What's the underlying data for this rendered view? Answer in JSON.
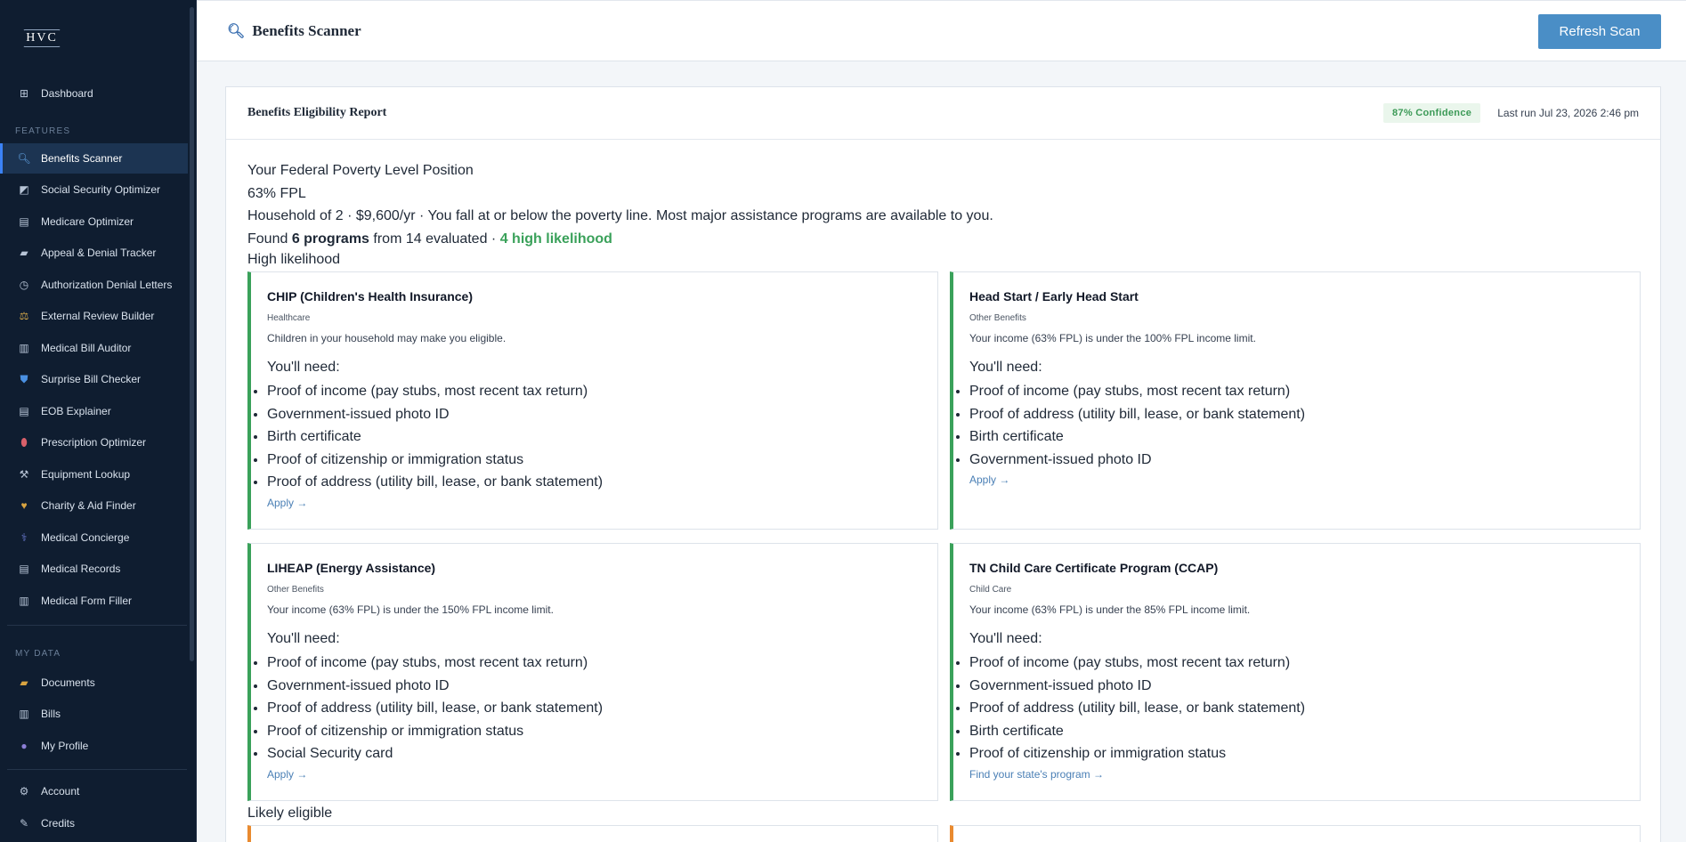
{
  "sidebar": {
    "logo": "HVC",
    "dashboard": "Dashboard",
    "features_label": "FEATURES",
    "features": [
      {
        "label": "Benefits Scanner",
        "icon": "magnifier-icon",
        "active": true
      },
      {
        "label": "Social Security Optimizer",
        "icon": "chart-icon"
      },
      {
        "label": "Medicare Optimizer",
        "icon": "document-icon"
      },
      {
        "label": "Appeal & Denial Tracker",
        "icon": "folder-icon"
      },
      {
        "label": "Authorization Denial Letters",
        "icon": "timer-icon"
      },
      {
        "label": "External Review Builder",
        "icon": "scales-icon"
      },
      {
        "label": "Medical Bill Auditor",
        "icon": "clipboard-icon"
      },
      {
        "label": "Surprise Bill Checker",
        "icon": "shield-icon"
      },
      {
        "label": "EOB Explainer",
        "icon": "document-icon"
      },
      {
        "label": "Prescription Optimizer",
        "icon": "pill-icon"
      },
      {
        "label": "Equipment Lookup",
        "icon": "tools-icon"
      },
      {
        "label": "Charity & Aid Finder",
        "icon": "heart-icon"
      },
      {
        "label": "Medical Concierge",
        "icon": "stethoscope-icon"
      },
      {
        "label": "Medical Records",
        "icon": "records-icon"
      },
      {
        "label": "Medical Form Filler",
        "icon": "form-icon"
      }
    ],
    "my_data_label": "MY DATA",
    "my_data": [
      {
        "label": "Documents",
        "icon": "folder-icon"
      },
      {
        "label": "Bills",
        "icon": "bill-icon"
      },
      {
        "label": "My Profile",
        "icon": "user-icon"
      }
    ],
    "account": [
      {
        "label": "Account",
        "icon": "gear-icon"
      },
      {
        "label": "Credits",
        "icon": "credits-icon"
      }
    ]
  },
  "header": {
    "title": "Benefits Scanner",
    "refresh_label": "Refresh Scan"
  },
  "report": {
    "title": "Benefits Eligibility Report",
    "confidence": "87% Confidence",
    "last_run": "Last run Jul 23, 2026 2:46 pm",
    "fpl_heading": "Your Federal Poverty Level Position",
    "fpl_value": "63% FPL",
    "household_line": "Household of 2 · $9,600/yr · You fall at or below the poverty line. Most major assistance programs are available to you.",
    "found_prefix": "Found ",
    "found_count": "6 programs",
    "found_middle": " from 14 evaluated · ",
    "found_high": "4 high likelihood",
    "group_high": "High likelihood",
    "group_likely": "Likely eligible",
    "needs_label": "You'll need:",
    "cards": [
      {
        "title": "CHIP (Children's Health Insurance)",
        "category": "Healthcare",
        "description": "Children in your household may make you eligible.",
        "items": [
          "Proof of income (pay stubs, most recent tax return)",
          "Government-issued photo ID",
          "Birth certificate",
          "Proof of citizenship or immigration status",
          "Proof of address (utility bill, lease, or bank statement)"
        ],
        "apply": "Apply →"
      },
      {
        "title": "Head Start / Early Head Start",
        "category": "Other Benefits",
        "description": "Your income (63% FPL) is under the 100% FPL income limit.",
        "items": [
          "Proof of income (pay stubs, most recent tax return)",
          "Proof of address (utility bill, lease, or bank statement)",
          "Birth certificate",
          "Government-issued photo ID"
        ],
        "apply": "Apply →"
      },
      {
        "title": "LIHEAP (Energy Assistance)",
        "category": "Other Benefits",
        "description": "Your income (63% FPL) is under the 150% FPL income limit.",
        "items": [
          "Proof of income (pay stubs, most recent tax return)",
          "Government-issued photo ID",
          "Proof of address (utility bill, lease, or bank statement)",
          "Proof of citizenship or immigration status",
          "Social Security card"
        ],
        "apply": "Apply →"
      },
      {
        "title": "TN Child Care Certificate Program (CCAP)",
        "category": "Child Care",
        "description": "Your income (63% FPL) is under the 85% FPL income limit.",
        "items": [
          "Proof of income (pay stubs, most recent tax return)",
          "Government-issued photo ID",
          "Proof of address (utility bill, lease, or bank statement)",
          "Birth certificate",
          "Proof of citizenship or immigration status"
        ],
        "apply": "Find your state's program →"
      }
    ]
  }
}
